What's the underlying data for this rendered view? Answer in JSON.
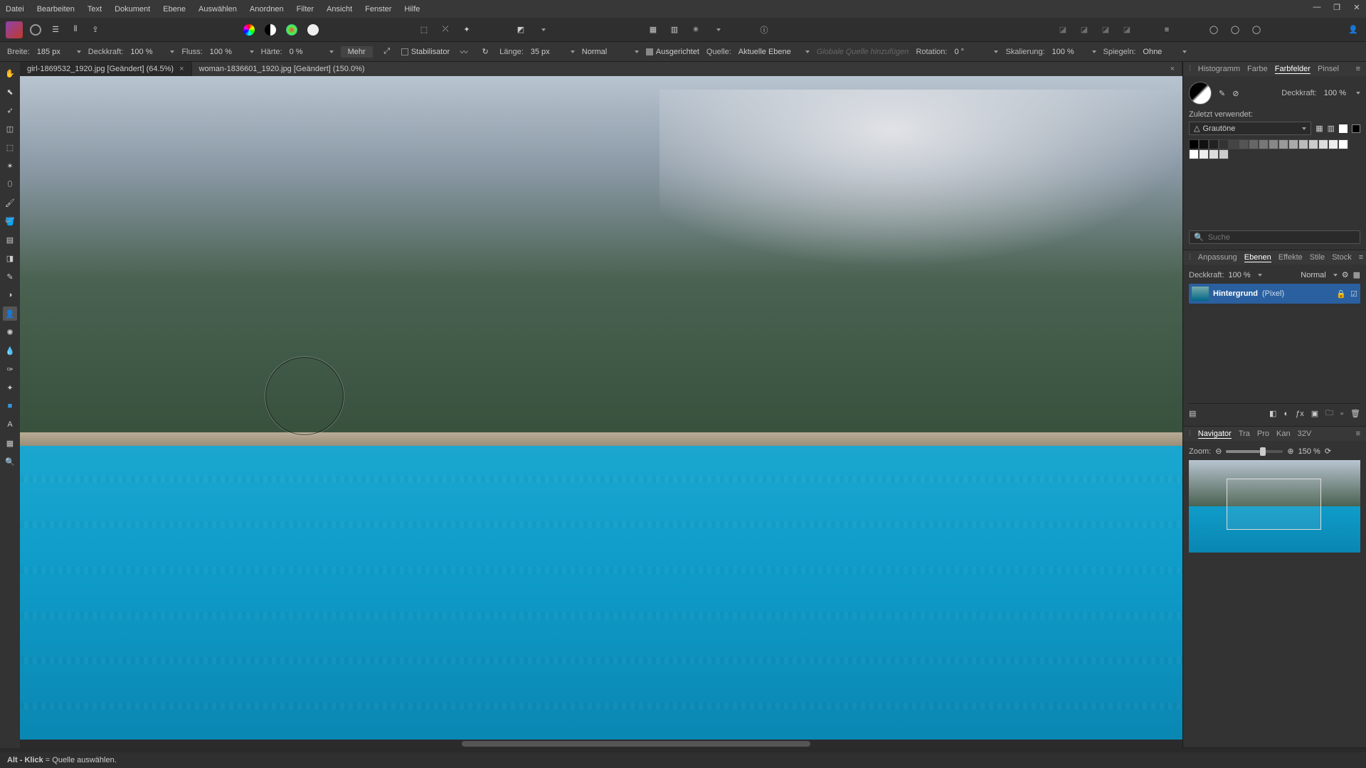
{
  "menu": {
    "items": [
      "Datei",
      "Bearbeiten",
      "Text",
      "Dokument",
      "Ebene",
      "Auswählen",
      "Anordnen",
      "Filter",
      "Ansicht",
      "Fenster",
      "Hilfe"
    ]
  },
  "win": {
    "min": "—",
    "max": "❐",
    "close": "✕"
  },
  "context_bar": {
    "breite_lbl": "Breite:",
    "breite": "185 px",
    "deckkraft_lbl": "Deckkraft:",
    "deckkraft": "100 %",
    "fluss_lbl": "Fluss:",
    "fluss": "100 %",
    "haerte_lbl": "Härte:",
    "haerte": "0 %",
    "mehr": "Mehr",
    "stabilisator": "Stabilisator",
    "laenge_lbl": "Länge:",
    "laenge": "35 px",
    "blend": "Normal",
    "ausgerichtet": "Ausgerichtet",
    "quelle_lbl": "Quelle:",
    "quelle": "Aktuelle Ebene",
    "global_placeholder": "Globale Quelle hinzufügen",
    "rotation_lbl": "Rotation:",
    "rotation": "0 °",
    "skalierung_lbl": "Skalierung:",
    "skalierung": "100 %",
    "spiegeln_lbl": "Spiegeln:",
    "spiegeln": "Ohne"
  },
  "tabs": [
    {
      "label": "girl-1869532_1920.jpg [Geändert] (64.5%)",
      "active": true
    },
    {
      "label": "woman-1836601_1920.jpg [Geändert] (150.0%)",
      "active": false
    }
  ],
  "right_top_tabs": [
    "Histogramm",
    "Farbe",
    "Farbfelder",
    "Pinsel"
  ],
  "right_top_active": "Farbfelder",
  "farbfelder": {
    "deckkraft_lbl": "Deckkraft:",
    "deckkraft": "100 %",
    "zuletzt": "Zuletzt verwendet:",
    "preset": "Grautöne"
  },
  "search_placeholder": "Suche",
  "panel_tabs": [
    "Anpassung",
    "Ebenen",
    "Effekte",
    "Stile",
    "Stock"
  ],
  "panel_active": "Ebenen",
  "layers": {
    "deckkraft_lbl": "Deckkraft:",
    "deckkraft": "100 %",
    "blend": "Normal",
    "layer_name": "Hintergrund",
    "layer_type": "(Pixel)"
  },
  "nav_tabs": [
    "Navigator",
    "Tra",
    "Pro",
    "Kan",
    "32V"
  ],
  "nav_active": "Navigator",
  "zoom": {
    "label": "Zoom:",
    "value": "150 %"
  },
  "status": {
    "hint_bold": "Alt - Klick",
    "hint_rest": " = Quelle auswählen."
  },
  "icons": {
    "hand": "✋",
    "move": "⬉",
    "crop": "◫",
    "brush": "🖌",
    "pencil": "✎",
    "erase": "◨",
    "fill": "🪣",
    "grad": "▤",
    "heal": "☄",
    "clone": "👤",
    "text": "A",
    "zoom": "🔍",
    "shape": "■",
    "mesh": "▦",
    "drop": "💧",
    "curve": "✑",
    "select": "⬚",
    "colorwheel": "◉",
    "halves": "◐",
    "light": "◯",
    "grid": "▦",
    "bars": "≣",
    "marker": "✳",
    "icon": "⚙",
    "add": "＋",
    "fx": "ƒx",
    "mask": "◧",
    "del": "🗑"
  }
}
